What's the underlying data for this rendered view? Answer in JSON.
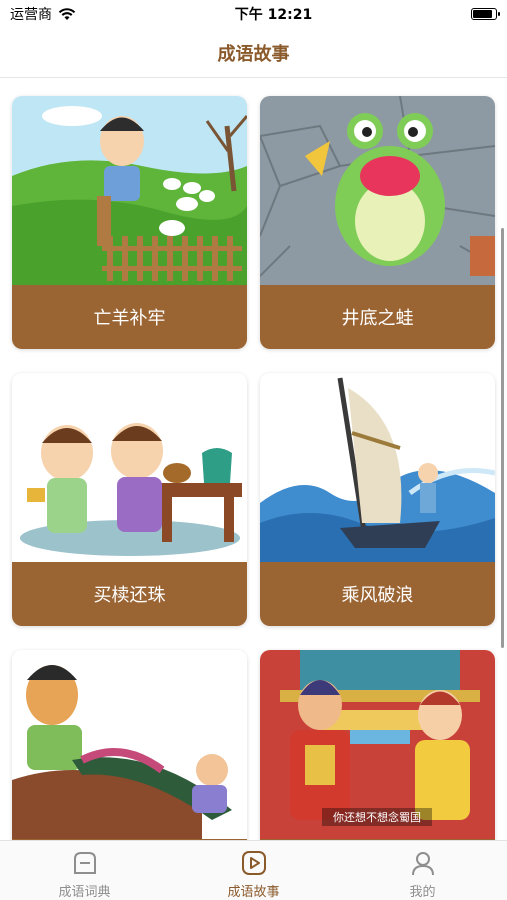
{
  "status_bar": {
    "carrier": "运营商",
    "time": "下午 12:21"
  },
  "nav": {
    "title": "成语故事"
  },
  "stories": [
    {
      "title": "亡羊补牢",
      "image": "sheep-pen-illustration"
    },
    {
      "title": "井底之蛙",
      "image": "frog-in-well-illustration"
    },
    {
      "title": "买椟还珠",
      "image": "pearl-box-illustration"
    },
    {
      "title": "乘风破浪",
      "image": "sailboat-waves-illustration"
    },
    {
      "title": "",
      "image": "boat-sleeper-illustration"
    },
    {
      "title": "",
      "image": "palace-court-illustration",
      "subtitle": "你还想不想念蜀国"
    }
  ],
  "tabs": [
    {
      "label": "成语词典",
      "icon": "dictionary-icon",
      "active": false
    },
    {
      "label": "成语故事",
      "icon": "play-icon",
      "active": true
    },
    {
      "label": "我的",
      "icon": "profile-icon",
      "active": false
    }
  ],
  "colors": {
    "accent": "#8b5a2b",
    "caption_bg": "#9b6433"
  }
}
